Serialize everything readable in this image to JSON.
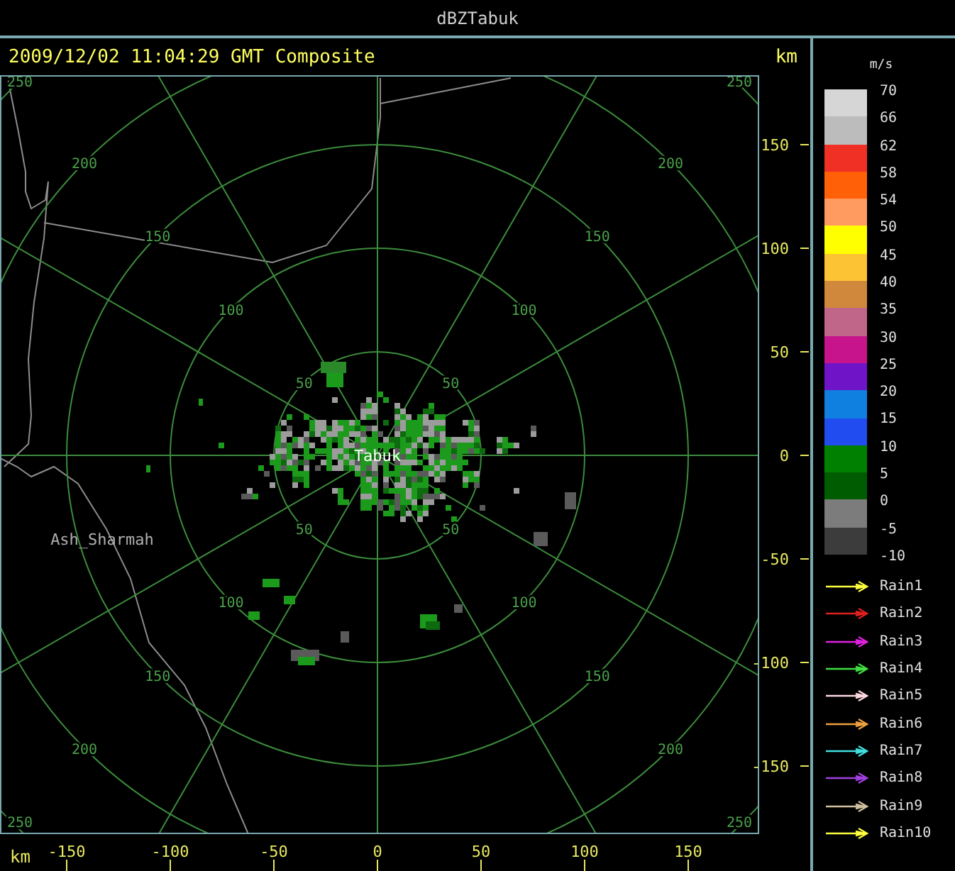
{
  "window": {
    "title": "dBZTabuk"
  },
  "header": {
    "timestamp": "2009/12/02 11:04:29 GMT Composite",
    "unit": "km"
  },
  "map": {
    "ring_labels": [
      "250",
      "250",
      "250",
      "250",
      "200",
      "200",
      "200",
      "200",
      "150",
      "150",
      "150",
      "150",
      "100",
      "100",
      "100",
      "100",
      "50",
      "50",
      "50",
      "50"
    ],
    "place_labels": [
      {
        "kind": "radar",
        "text": "Tabuk"
      },
      {
        "kind": "town",
        "text": "Ash_Sharmah"
      }
    ]
  },
  "y_axis": {
    "ticks": [
      "150",
      "100",
      "50",
      "0",
      "-50",
      "-100",
      "-150"
    ]
  },
  "x_axis": {
    "unit": "km",
    "ticks": [
      "-150",
      "-100",
      "-50",
      "0",
      "50",
      "100",
      "150"
    ]
  },
  "legend": {
    "unit": "m/s",
    "bands": [
      {
        "color": "#d6d6d6"
      },
      {
        "color": "#bcbcbc"
      },
      {
        "color": "#f03024"
      },
      {
        "color": "#ff6008"
      },
      {
        "color": "#ff9a60"
      },
      {
        "color": "#ffff00"
      },
      {
        "color": "#fcc434"
      },
      {
        "color": "#d0883c"
      },
      {
        "color": "#c06688"
      },
      {
        "color": "#c8148c"
      },
      {
        "color": "#7014c8"
      },
      {
        "color": "#1080e0"
      },
      {
        "color": "#204cf0"
      },
      {
        "color": "#008000"
      },
      {
        "color": "#005c00"
      },
      {
        "color": "#7c7c7c"
      },
      {
        "color": "#3c3c3c"
      }
    ],
    "labels": [
      "70",
      "66",
      "62",
      "58",
      "54",
      "50",
      "45",
      "40",
      "35",
      "30",
      "25",
      "20",
      "15",
      "10",
      "5",
      "0",
      "-5",
      "-10"
    ],
    "tracks": [
      {
        "label": "Rain1",
        "color": "#ffff40"
      },
      {
        "label": "Rain2",
        "color": "#e02020"
      },
      {
        "label": "Rain3",
        "color": "#e020e0"
      },
      {
        "label": "Rain4",
        "color": "#40e040"
      },
      {
        "label": "Rain5",
        "color": "#ffd8e0"
      },
      {
        "label": "Rain6",
        "color": "#f0a040"
      },
      {
        "label": "Rain7",
        "color": "#40e0e0"
      },
      {
        "label": "Rain8",
        "color": "#a040e0"
      },
      {
        "label": "Rain9",
        "color": "#d0c0a0"
      },
      {
        "label": "Rain10",
        "color": "#ffff40"
      }
    ]
  }
}
